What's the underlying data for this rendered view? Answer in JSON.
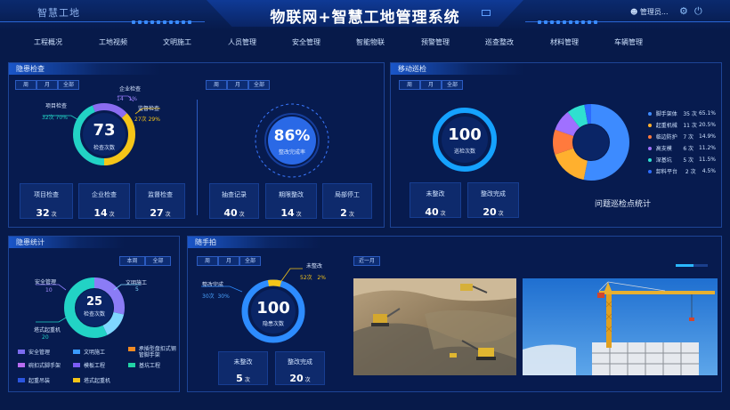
{
  "header": {
    "brand": "智慧工地",
    "title": "物联网+智慧工地管理系统",
    "user": "管理员...",
    "icons": [
      "message-icon",
      "user-icon",
      "gear-icon",
      "power-icon"
    ]
  },
  "nav": [
    "工程概况",
    "工地视频",
    "文明施工",
    "人员管理",
    "安全管理",
    "智能物联",
    "预警管理",
    "巡查整改",
    "材料管理",
    "车辆管理"
  ],
  "hazard_check": {
    "title": "隐患检查",
    "tabs": [
      "周",
      "月",
      "全部"
    ],
    "donut": {
      "value": "73",
      "label": "检查次数",
      "callouts": [
        {
          "name": "项目检查",
          "count": "32次",
          "pct": "70%",
          "value": 32,
          "color": "#22d3c5"
        },
        {
          "name": "企业检查",
          "count": "14",
          "pct": "1%",
          "value": 14,
          "color": "#8b6cf0"
        },
        {
          "name": "监督检查",
          "count": "27次",
          "pct": "29%",
          "value": 27,
          "color": "#f5c518"
        }
      ]
    },
    "stats": [
      {
        "label": "项目检查",
        "value": "32",
        "unit": "次"
      },
      {
        "label": "企业检查",
        "value": "14",
        "unit": "次"
      },
      {
        "label": "监督检查",
        "value": "27",
        "unit": "次"
      }
    ],
    "rect": {
      "tabs": [
        "周",
        "月",
        "全部"
      ],
      "percent": "86%",
      "percent_value": 86,
      "label": "整改完成率",
      "stats": [
        {
          "label": "抽查记录",
          "value": "40",
          "unit": "次"
        },
        {
          "label": "期限整改",
          "value": "14",
          "unit": "次"
        },
        {
          "label": "局部停工",
          "value": "2",
          "unit": "次"
        }
      ]
    }
  },
  "mobile_patrol": {
    "title": "移动巡检",
    "tabs": [
      "周",
      "月",
      "全部"
    ],
    "donut": {
      "value": "100",
      "label": "巡检次数"
    },
    "stats": [
      {
        "label": "未整改",
        "value": "40",
        "unit": "次"
      },
      {
        "label": "整改完成",
        "value": "20",
        "unit": "次"
      }
    ],
    "pie_title": "问题巡检点统计",
    "pie_legend": [
      {
        "name": "脚手架体",
        "count": "35 次",
        "pct": "65.1%",
        "value": 35,
        "color": "#3d8bff"
      },
      {
        "name": "起重机械",
        "count": "11 次",
        "pct": "20.5%",
        "value": 11,
        "color": "#ffb02e"
      },
      {
        "name": "临边防护",
        "count": "7 次",
        "pct": "14.9%",
        "value": 7,
        "color": "#ff7a3d"
      },
      {
        "name": "高支模",
        "count": "6 次",
        "pct": "11.2%",
        "value": 6,
        "color": "#a070ff"
      },
      {
        "name": "深基坑",
        "count": "5 次",
        "pct": "11.5%",
        "value": 5,
        "color": "#2fe0d0"
      },
      {
        "name": "卸料平台",
        "count": "2 次",
        "pct": "4.5%",
        "value": 2,
        "color": "#2c6bff"
      }
    ]
  },
  "hazard_stats": {
    "title": "隐患统计",
    "tabs": [
      "本周",
      "全部"
    ],
    "donut": {
      "value": "25",
      "label": "检查次数"
    },
    "callouts": [
      {
        "name": "安全管理",
        "count": "10"
      },
      {
        "name": "文明施工",
        "count": "5"
      },
      {
        "name": "塔式起重机",
        "count": "20"
      }
    ],
    "segments": [
      {
        "value": 10,
        "color": "#8b7cf6"
      },
      {
        "value": 5,
        "color": "#7fd7ff"
      },
      {
        "value": 20,
        "color": "#22d3c5"
      }
    ],
    "legend": [
      {
        "name": "安全管理",
        "color": "#7c6cf0"
      },
      {
        "name": "文明施工",
        "color": "#3a9bff"
      },
      {
        "name": "承插型盘扣式钢管脚手架",
        "color": "#f08a24"
      },
      {
        "name": "碗扣式脚手架",
        "color": "#b86cf0"
      },
      {
        "name": "模板工程",
        "color": "#7b5cf5"
      },
      {
        "name": "基坑工程",
        "color": "#22d3a5"
      },
      {
        "name": "起重吊装",
        "color": "#2b55e0"
      },
      {
        "name": "塔式起重机",
        "color": "#f5c518"
      }
    ]
  },
  "snapshot": {
    "title": "随手拍",
    "tabs": [
      "周",
      "月",
      "全部"
    ],
    "donut": {
      "value": "100",
      "label": "隐患次数"
    },
    "callouts": [
      {
        "name": "未整改",
        "count": "52次",
        "pct": "2%",
        "color": "#f5c518"
      },
      {
        "name": "整改完成",
        "count": "30次",
        "pct": "30%",
        "color": "#2d8cff"
      }
    ],
    "stats": [
      {
        "label": "未整改",
        "value": "5",
        "unit": "次"
      },
      {
        "label": "整改完成",
        "value": "20",
        "unit": "次"
      }
    ],
    "photo_tab": "近一月"
  }
}
